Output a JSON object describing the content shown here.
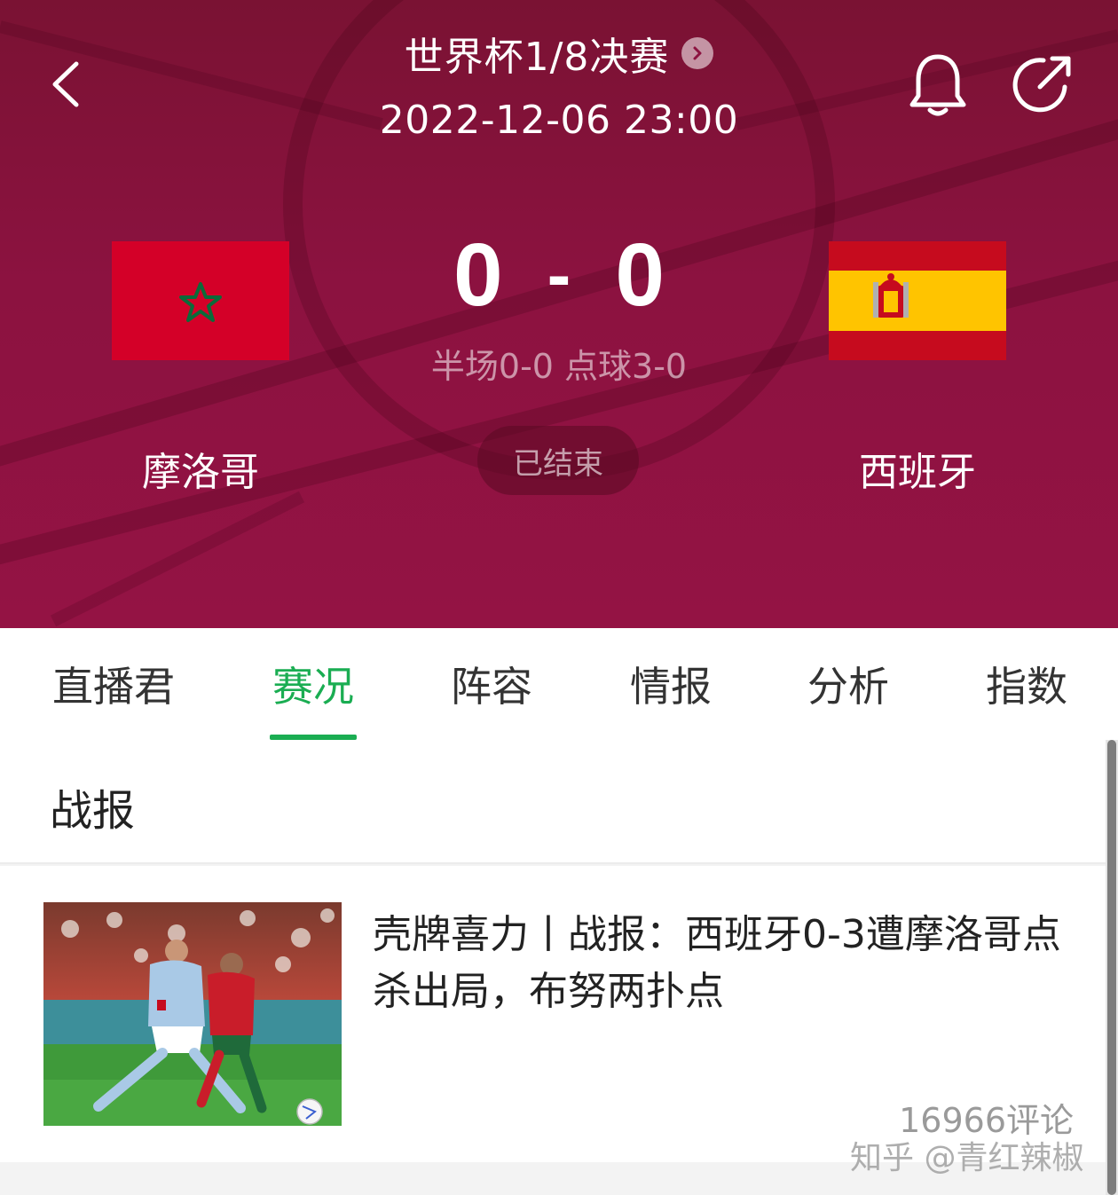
{
  "header": {
    "stage": "世界杯1/8决赛",
    "datetime": "2022-12-06 23:00",
    "status": "已结束",
    "back_icon": "chevron-left-icon",
    "bell_icon": "bell-icon",
    "share_icon": "share-icon"
  },
  "match": {
    "home": {
      "name": "摩洛哥"
    },
    "away": {
      "name": "西班牙"
    },
    "home_score": "0",
    "separator": "-",
    "away_score": "0",
    "detail": "半场0-0 点球3-0"
  },
  "tabs": [
    {
      "label": "直播君"
    },
    {
      "label": "赛况"
    },
    {
      "label": "阵容"
    },
    {
      "label": "情报"
    },
    {
      "label": "分析"
    },
    {
      "label": "指数"
    }
  ],
  "active_tab": "赛况",
  "section": {
    "title": "战报"
  },
  "news": [
    {
      "title": "壳牌喜力丨战报：西班牙0-3遭摩洛哥点杀出局，布努两扑点",
      "comments": "16966评论"
    }
  ],
  "watermark": "知乎 @青红辣椒",
  "colors": {
    "header_bg": "#8c1240",
    "accent_green": "#1aad52",
    "morocco_red": "#d40028",
    "morocco_star": "#0b6b3a",
    "spain_red": "#c60b1e",
    "spain_yellow": "#ffc400"
  }
}
